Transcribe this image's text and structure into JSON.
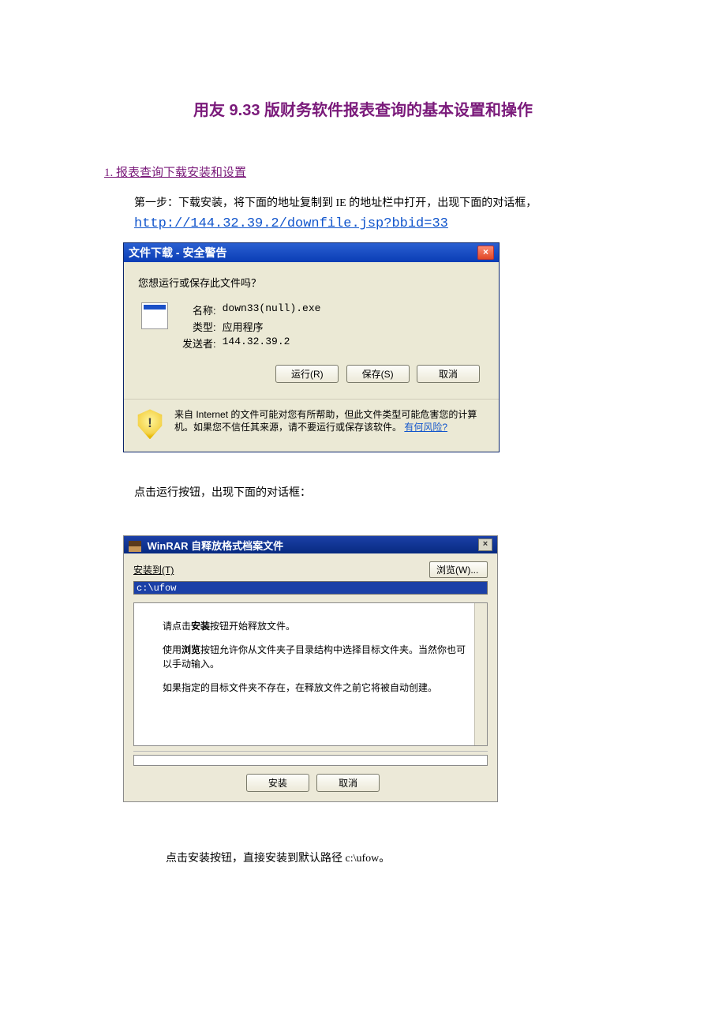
{
  "doc": {
    "title": "用友 9.33 版财务软件报表查询的基本设置和操作",
    "section1_heading": "1. 报表查询下载安装和设置",
    "step1_text": "第一步：下载安装，将下面的地址复制到 IE 的地址栏中打开，出现下面的对话框，",
    "download_url": "http://144.32.39.2/downfile.jsp?bbid=33",
    "between_text": "点击运行按钮，出现下面的对话框：",
    "after_text": "点击安装按钮，直接安装到默认路径 c:\\ufow。"
  },
  "dlg1": {
    "titlebar_text": "文件下载 - 安全警告",
    "question": "您想运行或保存此文件吗？",
    "label_name": "名称:",
    "value_name": "down33(null).exe",
    "label_type": "类型:",
    "value_type": "应用程序",
    "label_sender": "发送者:",
    "value_sender": "144.32.39.2",
    "btn_run": "运行(R)",
    "btn_save": "保存(S)",
    "btn_cancel": "取消",
    "footer_text_1": "来自 Internet 的文件可能对您有所帮助，但此文件类型可能危害您的计算机。如果您不信任其来源，请不要运行或保存该软件。",
    "risk_link": "有何风险?"
  },
  "dlg2": {
    "titlebar_text": "WinRAR 自释放格式档案文件",
    "install_to_label": "安装到(T)",
    "browse_btn": "浏览(W)...",
    "path_value": "c:\\ufow",
    "panel_line1_pre": "请点击",
    "panel_line1_bold": "安装",
    "panel_line1_post": "按钮开始释放文件。",
    "panel_line2_pre": "使用",
    "panel_line2_bold": "浏览",
    "panel_line2_post": "按钮允许你从文件夹子目录结构中选择目标文件夹。当然你也可以手动输入。",
    "panel_line3": "如果指定的目标文件夹不存在，在释放文件之前它将被自动创建。",
    "btn_install": "安装",
    "btn_cancel": "取消"
  }
}
